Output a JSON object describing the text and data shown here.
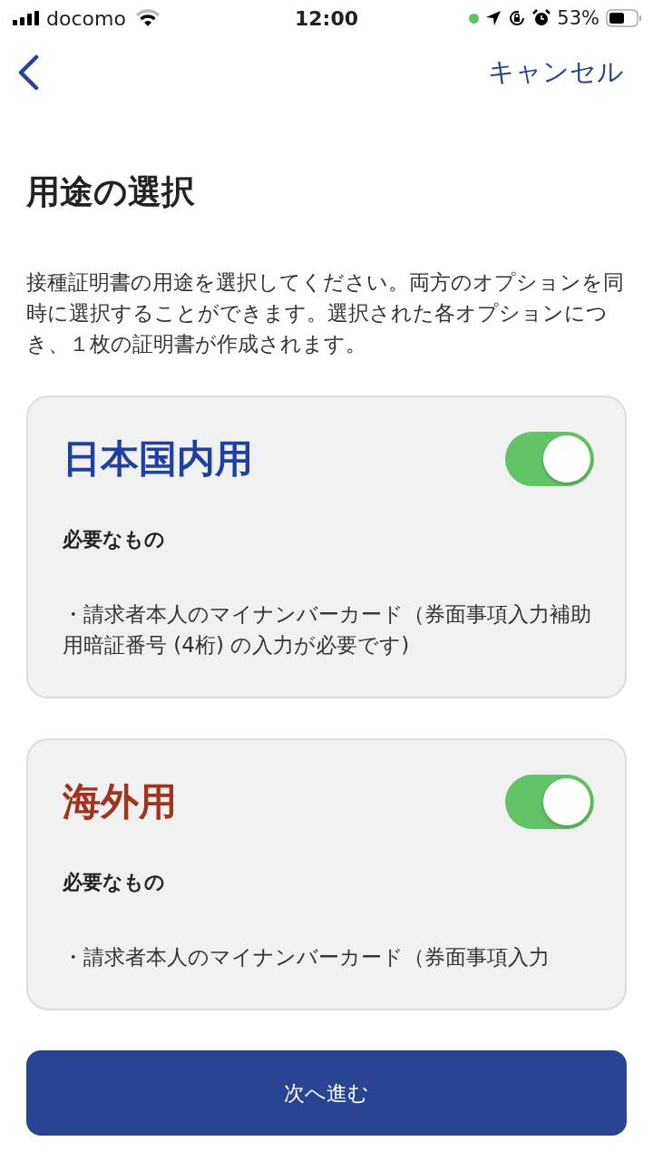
{
  "status_bar": {
    "carrier": "docomo",
    "time": "12:00",
    "battery": "53%"
  },
  "nav": {
    "cancel": "キャンセル"
  },
  "title": "用途の選択",
  "description": "接種証明書の用途を選択してください。両方のオプションを同時に選択することができます。選択された各オプションにつき、１枚の証明書が作成されます。",
  "options": [
    {
      "title": "日本国内用",
      "color": "#1e3fa3",
      "on": true,
      "requirements_label": "必要なもの",
      "requirements": "・請求者本人のマイナンバーカード（券面事項入力補助用暗証番号 (4桁) の入力が必要です)"
    },
    {
      "title": "海外用",
      "color": "#a3321c",
      "on": true,
      "requirements_label": "必要なもの",
      "requirements": "・請求者本人のマイナンバーカード（券面事項入力"
    }
  ],
  "next_button": "次へ進む"
}
